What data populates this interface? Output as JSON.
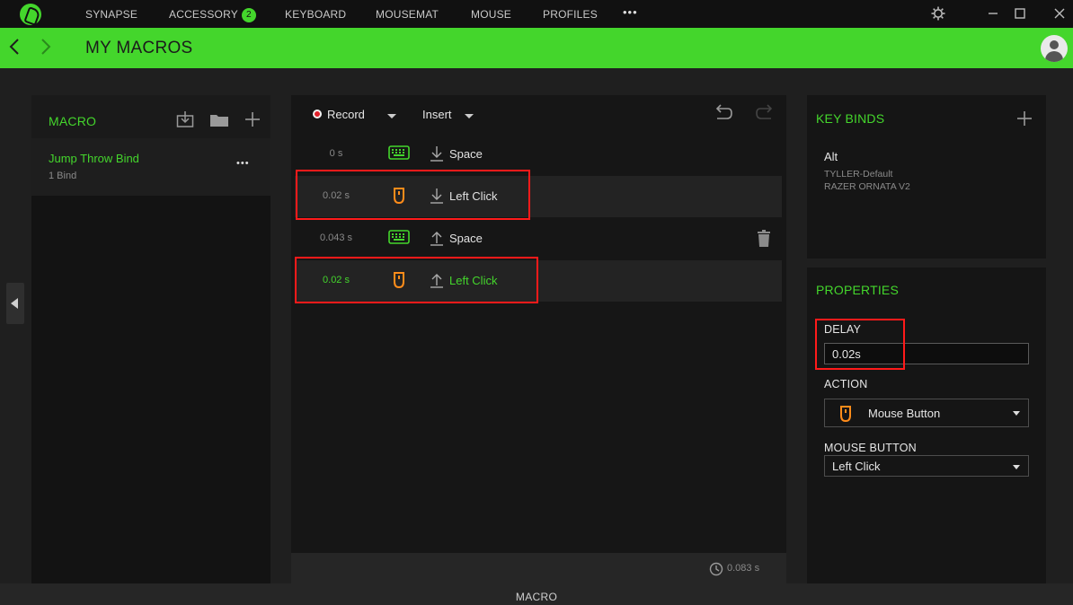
{
  "nav": {
    "items": [
      "SYNAPSE",
      "ACCESSORY",
      "KEYBOARD",
      "MOUSEMAT",
      "MOUSE",
      "PROFILES"
    ],
    "accessory_badge": "2",
    "more": "•••"
  },
  "header": {
    "title": "MY MACROS"
  },
  "macro_panel": {
    "title": "MACRO",
    "item": {
      "name": "Jump Throw Bind",
      "sub": "1 Bind",
      "more": "•••"
    }
  },
  "sequence": {
    "record_label": "Record",
    "insert_label": "Insert",
    "rows": [
      {
        "time": "0 s",
        "device": "keyboard-icon",
        "direction": "down",
        "label": "Space"
      },
      {
        "time": "0.02 s",
        "device": "mouse-icon",
        "direction": "down",
        "label": "Left Click"
      },
      {
        "time": "0.043 s",
        "device": "keyboard-icon",
        "direction": "up",
        "label": "Space"
      },
      {
        "time": "0.02 s",
        "device": "mouse-icon",
        "direction": "up",
        "label": "Left Click",
        "selected": true
      }
    ],
    "total_time": "0.083 s"
  },
  "keybinds": {
    "title": "KEY BINDS",
    "key": "Alt",
    "profile": "TYLLER-Default",
    "device": "RAZER ORNATA V2"
  },
  "properties": {
    "title": "PROPERTIES",
    "delay_label": "DELAY",
    "delay_value": "0.02s",
    "action_label": "ACTION",
    "action_value": "Mouse Button",
    "mouse_button_label": "MOUSE BUTTON",
    "mouse_button_value": "Left Click"
  },
  "bottom_bar": {
    "label": "MACRO"
  },
  "colors": {
    "accent": "#44d62c",
    "mouse": "#ff8c1a",
    "highlight": "#ff1a1a"
  }
}
